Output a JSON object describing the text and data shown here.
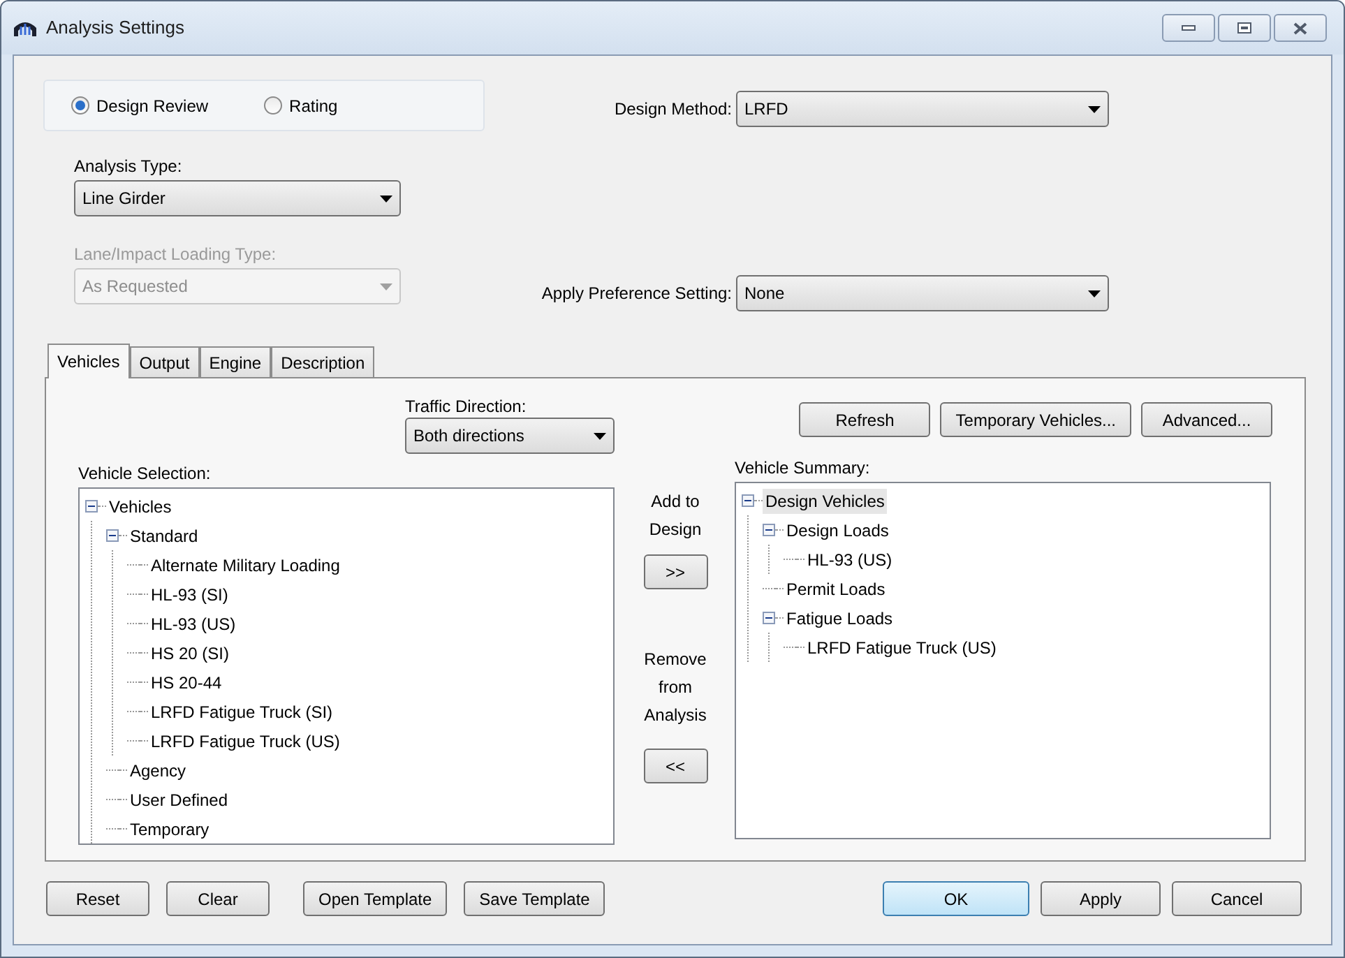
{
  "window": {
    "title": "Analysis Settings"
  },
  "mode_options": [
    {
      "label": "Design Review",
      "selected": true
    },
    {
      "label": "Rating",
      "selected": false
    }
  ],
  "design_method": {
    "label": "Design Method:",
    "value": "LRFD"
  },
  "analysis_type": {
    "label": "Analysis Type:",
    "value": "Line Girder"
  },
  "lane_impact_loading_type": {
    "label": "Lane/Impact Loading Type:",
    "value": "As Requested",
    "disabled": true
  },
  "apply_preference_setting": {
    "label": "Apply Preference Setting:",
    "value": "None"
  },
  "tabs": [
    {
      "label": "Vehicles",
      "selected": true
    },
    {
      "label": "Output",
      "selected": false
    },
    {
      "label": "Engine",
      "selected": false
    },
    {
      "label": "Description",
      "selected": false
    }
  ],
  "traffic_direction": {
    "label": "Traffic Direction:",
    "value": "Both directions"
  },
  "panel_buttons": [
    "Refresh",
    "Temporary Vehicles...",
    "Advanced..."
  ],
  "vehicle_selection": {
    "label": "Vehicle Selection:",
    "tree": [
      {
        "label": "Vehicles",
        "expanded": true,
        "selected": false,
        "children": [
          {
            "label": "Standard",
            "expanded": true,
            "selected": false,
            "children": [
              {
                "label": "Alternate Military Loading",
                "selected": false
              },
              {
                "label": "HL-93 (SI)",
                "selected": false
              },
              {
                "label": "HL-93 (US)",
                "selected": false
              },
              {
                "label": "HS 20 (SI)",
                "selected": false
              },
              {
                "label": "HS 20-44",
                "selected": false
              },
              {
                "label": "LRFD Fatigue Truck (SI)",
                "selected": false
              },
              {
                "label": "LRFD Fatigue Truck (US)",
                "selected": false
              }
            ]
          },
          {
            "label": "Agency",
            "selected": false
          },
          {
            "label": "User Defined",
            "selected": false
          },
          {
            "label": "Temporary",
            "selected": false
          }
        ]
      }
    ]
  },
  "add_to_design": {
    "label": "Add to Design",
    "button": ">>"
  },
  "remove_from_analysis": {
    "label": "Remove from Analysis",
    "button": "<<"
  },
  "vehicle_summary": {
    "label": "Vehicle Summary:",
    "tree": [
      {
        "label": "Design Vehicles",
        "expanded": true,
        "selected": true,
        "children": [
          {
            "label": "Design Loads",
            "expanded": true,
            "selected": false,
            "children": [
              {
                "label": "HL-93 (US)",
                "selected": false
              }
            ]
          },
          {
            "label": "Permit Loads",
            "selected": false
          },
          {
            "label": "Fatigue Loads",
            "expanded": true,
            "selected": false,
            "children": [
              {
                "label": "LRFD Fatigue Truck (US)",
                "selected": false
              }
            ]
          }
        ]
      }
    ]
  },
  "footer_left_buttons": [
    "Reset",
    "Clear",
    "Open Template",
    "Save Template"
  ],
  "footer_right_buttons": [
    {
      "label": "OK",
      "default": true
    },
    {
      "label": "Apply",
      "default": false
    },
    {
      "label": "Cancel",
      "default": false
    }
  ]
}
